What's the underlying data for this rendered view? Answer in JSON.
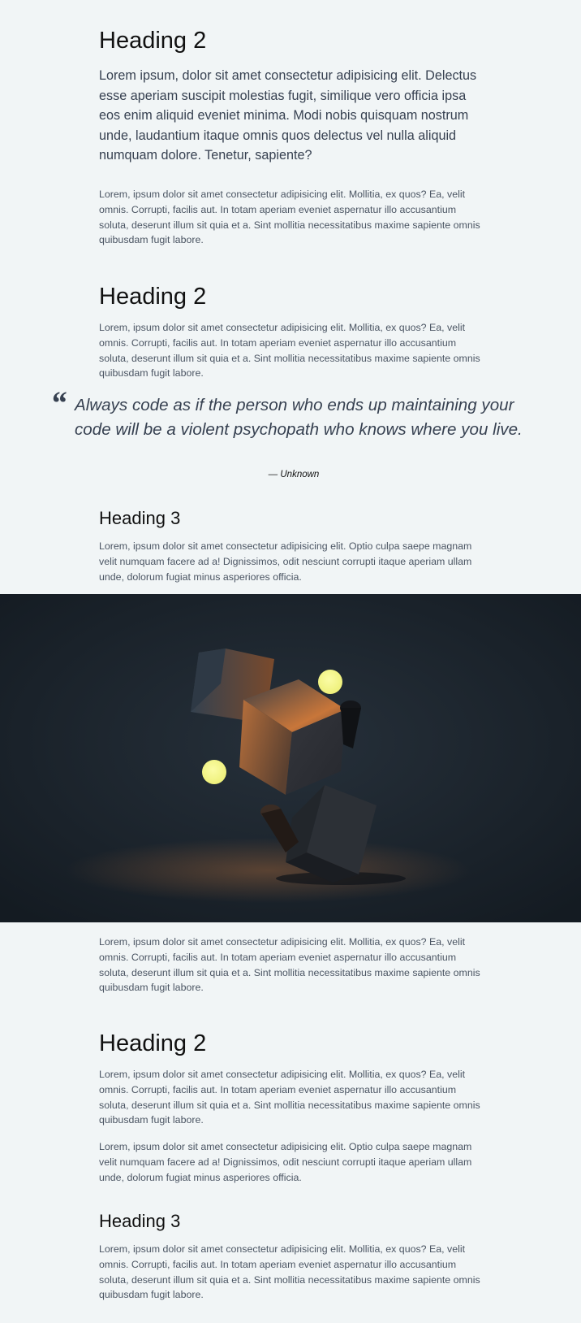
{
  "sections": {
    "s1": {
      "heading": "Heading 2",
      "lead": "Lorem ipsum, dolor sit amet consectetur adipisicing elit. Delectus esse aperiam suscipit molestias fugit, similique vero officia ipsa eos enim aliquid eveniet minima. Modi nobis quisquam nostrum unde, laudantium itaque omnis quos delectus vel nulla aliquid numquam dolore. Tenetur, sapiente?",
      "body": "Lorem, ipsum dolor sit amet consectetur adipisicing elit. Mollitia, ex quos? Ea, velit omnis. Corrupti, facilis aut. In totam aperiam eveniet aspernatur illo accusantium soluta, deserunt illum sit quia et a. Sint mollitia necessitatibus maxime sapiente omnis quibusdam fugit labore."
    },
    "s2": {
      "heading": "Heading 2",
      "body": "Lorem, ipsum dolor sit amet consectetur adipisicing elit. Mollitia, ex quos? Ea, velit omnis. Corrupti, facilis aut. In totam aperiam eveniet aspernatur illo accusantium soluta, deserunt illum sit quia et a. Sint mollitia necessitatibus maxime sapiente omnis quibusdam fugit labore."
    },
    "quote": {
      "mark": "“",
      "text": "Always code as if the person who ends up maintaining your code will be a violent psychopath who knows where you live.",
      "cite": "— Unknown"
    },
    "s3": {
      "heading": "Heading 3",
      "body": "Lorem, ipsum dolor sit amet consectetur adipisicing elit. Optio culpa saepe magnam velit numquam facere ad a! Dignissimos, odit nesciunt corrupti itaque aperiam ullam unde, dolorum fugiat minus asperiores officia."
    },
    "after_image": {
      "body": "Lorem, ipsum dolor sit amet consectetur adipisicing elit. Mollitia, ex quos? Ea, velit omnis. Corrupti, facilis aut. In totam aperiam eveniet aspernatur illo accusantium soluta, deserunt illum sit quia et a. Sint mollitia necessitatibus maxime sapiente omnis quibusdam fugit labore."
    },
    "s4": {
      "heading": "Heading 2",
      "body1": "Lorem, ipsum dolor sit amet consectetur adipisicing elit. Mollitia, ex quos? Ea, velit omnis. Corrupti, facilis aut. In totam aperiam eveniet aspernatur illo accusantium soluta, deserunt illum sit quia et a. Sint mollitia necessitatibus maxime sapiente omnis quibusdam fugit labore.",
      "body2": "Lorem, ipsum dolor sit amet consectetur adipisicing elit. Optio culpa saepe magnam velit numquam facere ad a! Dignissimos, odit nesciunt corrupti itaque aperiam ullam unde, dolorum fugiat minus asperiores officia."
    },
    "s5": {
      "heading": "Heading 3",
      "body": "Lorem, ipsum dolor sit amet consectetur adipisicing elit. Mollitia, ex quos? Ea, velit omnis. Corrupti, facilis aut. In totam aperiam eveniet aspernatur illo accusantium soluta, deserunt illum sit quia et a. Sint mollitia necessitatibus maxime sapiente omnis quibusdam fugit labore."
    }
  },
  "colors": {
    "page_bg": "#f1f5f6",
    "heading": "#111111",
    "text": "#4b5563",
    "hero_bg": "#1b232c",
    "accent_light": "#f7f98a",
    "accent_warm": "#c97a3d"
  }
}
